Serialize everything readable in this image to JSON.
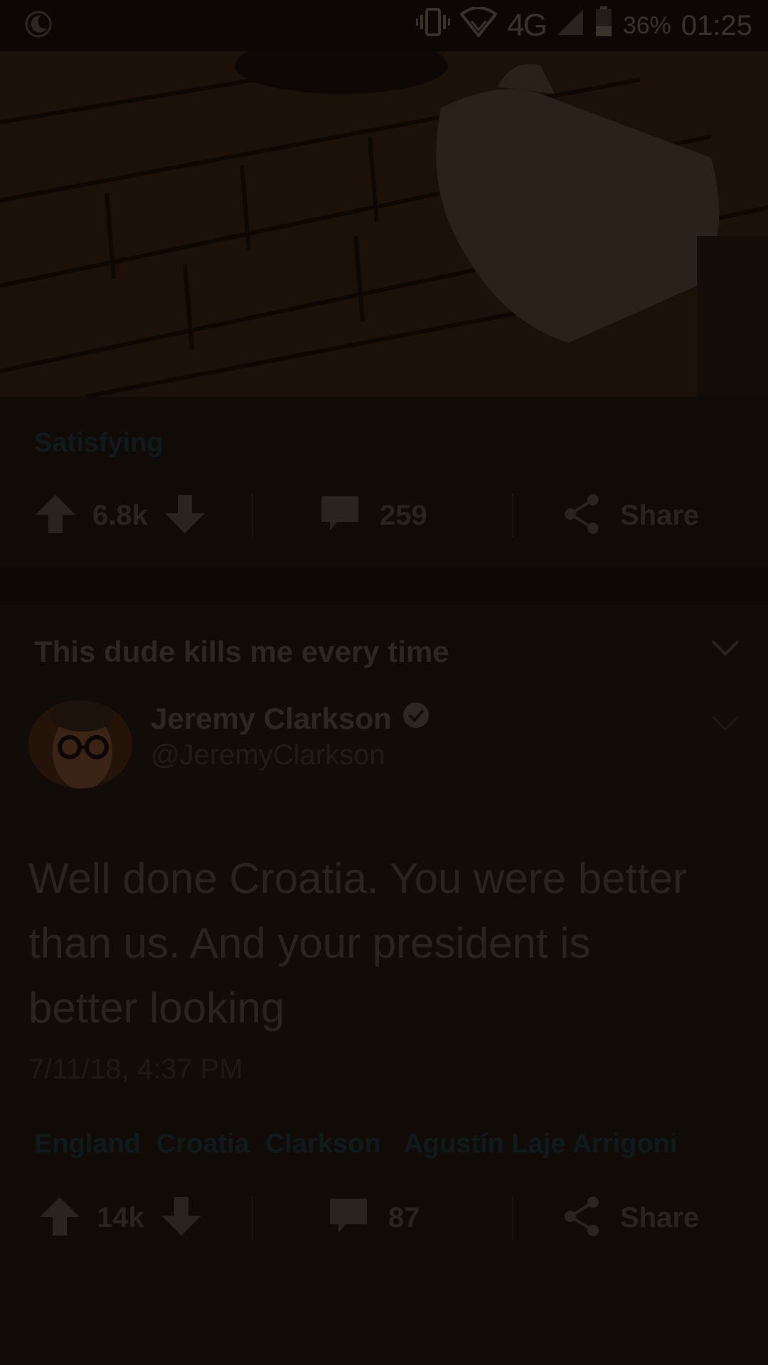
{
  "status_bar": {
    "network": "4G",
    "battery": "36%",
    "time": "01:25"
  },
  "post1": {
    "subreddit": "Satisfying",
    "upvotes": "6.8k",
    "comments": "259",
    "share_label": "Share"
  },
  "post2": {
    "title": "This dude kills me every time",
    "tweet": {
      "name": "Jeremy Clarkson",
      "handle": "@JeremyClarkson",
      "text": "Well done Croatia. You were better than us. And your president is better looking",
      "date": "7/11/18, 4:37 PM"
    },
    "tags": [
      "England",
      "Croatia",
      "Clarkson",
      "Agustín Laje Arrigoni"
    ],
    "upvotes": "14k",
    "comments": "87",
    "share_label": "Share"
  },
  "colors": {
    "background": "#0f0906",
    "dim_text": "#2a2420",
    "tag_text": "#0e1a1c"
  }
}
